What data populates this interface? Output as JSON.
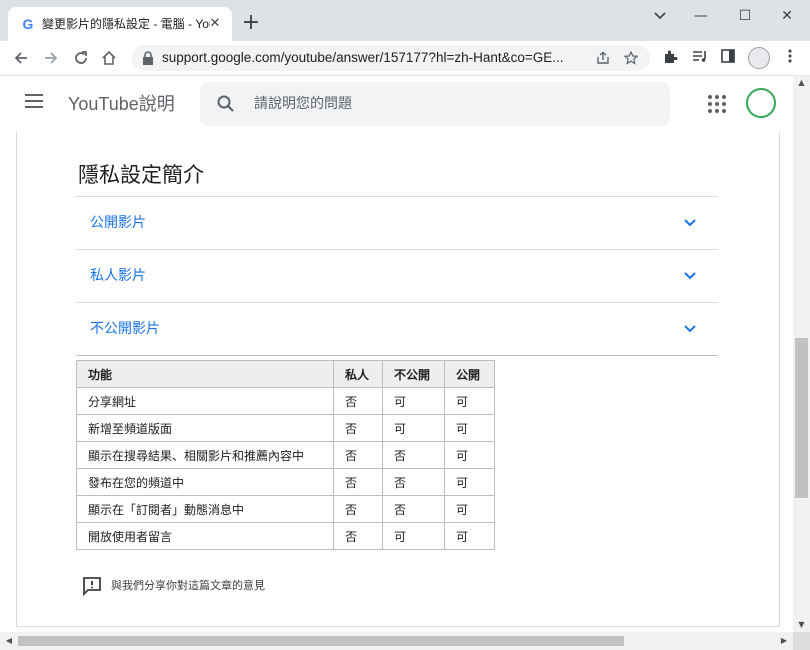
{
  "browser": {
    "tab_title": "變更影片的隱私設定 - 電腦 - You",
    "tab_favicon": "G",
    "tab_close": "✕",
    "new_tab": "+",
    "url": "support.google.com/youtube/answer/157177?hl=zh-Hant&co=GE...",
    "window_controls": {
      "minimize": "—",
      "maximize": "☐",
      "close": "✕"
    },
    "icons": [
      "back-arrow-icon",
      "forward-arrow-icon",
      "reload-icon",
      "home-icon",
      "lock-icon",
      "share-icon",
      "star-icon",
      "extensions-icon",
      "reading-list-icon",
      "side-panel-icon",
      "profile-icon",
      "menu-icon"
    ]
  },
  "header": {
    "brand": "YouTube說明",
    "search_placeholder": "請說明您的問題"
  },
  "article": {
    "title": "隱私設定簡介",
    "accordion": [
      {
        "label": "公開影片"
      },
      {
        "label": "私人影片"
      },
      {
        "label": "不公開影片"
      }
    ],
    "table": {
      "headers": [
        "功能",
        "私人",
        "不公開",
        "公開"
      ],
      "rows": [
        [
          "分享網址",
          "否",
          "可",
          "可"
        ],
        [
          "新增至頻道版面",
          "否",
          "可",
          "可"
        ],
        [
          "顯示在搜尋結果、相關影片和推薦內容中",
          "否",
          "否",
          "可"
        ],
        [
          "發布在您的頻道中",
          "否",
          "否",
          "可"
        ],
        [
          "顯示在「訂閱者」動態消息中",
          "否",
          "否",
          "可"
        ],
        [
          "開放使用者留言",
          "否",
          "可",
          "可"
        ]
      ]
    },
    "feedback": "與我們分享你對這篇文章的意見"
  },
  "colors": {
    "link": "#1a73e8",
    "tabbar": "#dee1e6",
    "table_header": "#eeeeee"
  }
}
